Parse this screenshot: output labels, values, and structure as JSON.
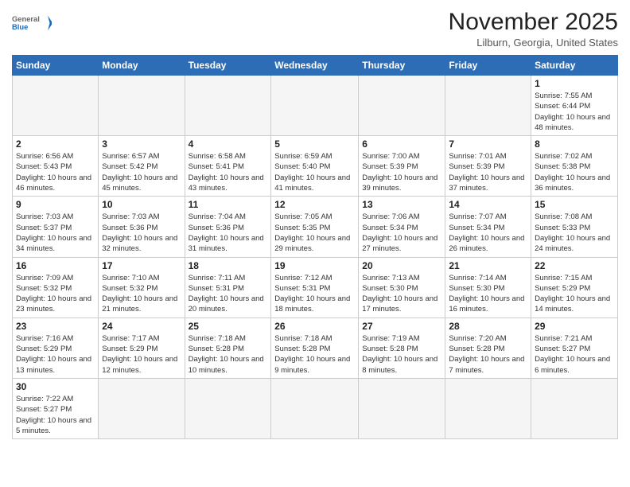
{
  "header": {
    "logo_general": "General",
    "logo_blue": "Blue",
    "month_title": "November 2025",
    "location": "Lilburn, Georgia, United States"
  },
  "days_of_week": [
    "Sunday",
    "Monday",
    "Tuesday",
    "Wednesday",
    "Thursday",
    "Friday",
    "Saturday"
  ],
  "weeks": [
    [
      {
        "day": "",
        "info": ""
      },
      {
        "day": "",
        "info": ""
      },
      {
        "day": "",
        "info": ""
      },
      {
        "day": "",
        "info": ""
      },
      {
        "day": "",
        "info": ""
      },
      {
        "day": "",
        "info": ""
      },
      {
        "day": "1",
        "info": "Sunrise: 7:55 AM\nSunset: 6:44 PM\nDaylight: 10 hours and 48 minutes."
      }
    ],
    [
      {
        "day": "2",
        "info": "Sunrise: 6:56 AM\nSunset: 5:43 PM\nDaylight: 10 hours and 46 minutes."
      },
      {
        "day": "3",
        "info": "Sunrise: 6:57 AM\nSunset: 5:42 PM\nDaylight: 10 hours and 45 minutes."
      },
      {
        "day": "4",
        "info": "Sunrise: 6:58 AM\nSunset: 5:41 PM\nDaylight: 10 hours and 43 minutes."
      },
      {
        "day": "5",
        "info": "Sunrise: 6:59 AM\nSunset: 5:40 PM\nDaylight: 10 hours and 41 minutes."
      },
      {
        "day": "6",
        "info": "Sunrise: 7:00 AM\nSunset: 5:39 PM\nDaylight: 10 hours and 39 minutes."
      },
      {
        "day": "7",
        "info": "Sunrise: 7:01 AM\nSunset: 5:39 PM\nDaylight: 10 hours and 37 minutes."
      },
      {
        "day": "8",
        "info": "Sunrise: 7:02 AM\nSunset: 5:38 PM\nDaylight: 10 hours and 36 minutes."
      }
    ],
    [
      {
        "day": "9",
        "info": "Sunrise: 7:03 AM\nSunset: 5:37 PM\nDaylight: 10 hours and 34 minutes."
      },
      {
        "day": "10",
        "info": "Sunrise: 7:03 AM\nSunset: 5:36 PM\nDaylight: 10 hours and 32 minutes."
      },
      {
        "day": "11",
        "info": "Sunrise: 7:04 AM\nSunset: 5:36 PM\nDaylight: 10 hours and 31 minutes."
      },
      {
        "day": "12",
        "info": "Sunrise: 7:05 AM\nSunset: 5:35 PM\nDaylight: 10 hours and 29 minutes."
      },
      {
        "day": "13",
        "info": "Sunrise: 7:06 AM\nSunset: 5:34 PM\nDaylight: 10 hours and 27 minutes."
      },
      {
        "day": "14",
        "info": "Sunrise: 7:07 AM\nSunset: 5:34 PM\nDaylight: 10 hours and 26 minutes."
      },
      {
        "day": "15",
        "info": "Sunrise: 7:08 AM\nSunset: 5:33 PM\nDaylight: 10 hours and 24 minutes."
      }
    ],
    [
      {
        "day": "16",
        "info": "Sunrise: 7:09 AM\nSunset: 5:32 PM\nDaylight: 10 hours and 23 minutes."
      },
      {
        "day": "17",
        "info": "Sunrise: 7:10 AM\nSunset: 5:32 PM\nDaylight: 10 hours and 21 minutes."
      },
      {
        "day": "18",
        "info": "Sunrise: 7:11 AM\nSunset: 5:31 PM\nDaylight: 10 hours and 20 minutes."
      },
      {
        "day": "19",
        "info": "Sunrise: 7:12 AM\nSunset: 5:31 PM\nDaylight: 10 hours and 18 minutes."
      },
      {
        "day": "20",
        "info": "Sunrise: 7:13 AM\nSunset: 5:30 PM\nDaylight: 10 hours and 17 minutes."
      },
      {
        "day": "21",
        "info": "Sunrise: 7:14 AM\nSunset: 5:30 PM\nDaylight: 10 hours and 16 minutes."
      },
      {
        "day": "22",
        "info": "Sunrise: 7:15 AM\nSunset: 5:29 PM\nDaylight: 10 hours and 14 minutes."
      }
    ],
    [
      {
        "day": "23",
        "info": "Sunrise: 7:16 AM\nSunset: 5:29 PM\nDaylight: 10 hours and 13 minutes."
      },
      {
        "day": "24",
        "info": "Sunrise: 7:17 AM\nSunset: 5:29 PM\nDaylight: 10 hours and 12 minutes."
      },
      {
        "day": "25",
        "info": "Sunrise: 7:18 AM\nSunset: 5:28 PM\nDaylight: 10 hours and 10 minutes."
      },
      {
        "day": "26",
        "info": "Sunrise: 7:18 AM\nSunset: 5:28 PM\nDaylight: 10 hours and 9 minutes."
      },
      {
        "day": "27",
        "info": "Sunrise: 7:19 AM\nSunset: 5:28 PM\nDaylight: 10 hours and 8 minutes."
      },
      {
        "day": "28",
        "info": "Sunrise: 7:20 AM\nSunset: 5:28 PM\nDaylight: 10 hours and 7 minutes."
      },
      {
        "day": "29",
        "info": "Sunrise: 7:21 AM\nSunset: 5:27 PM\nDaylight: 10 hours and 6 minutes."
      }
    ],
    [
      {
        "day": "30",
        "info": "Sunrise: 7:22 AM\nSunset: 5:27 PM\nDaylight: 10 hours and 5 minutes."
      },
      {
        "day": "",
        "info": ""
      },
      {
        "day": "",
        "info": ""
      },
      {
        "day": "",
        "info": ""
      },
      {
        "day": "",
        "info": ""
      },
      {
        "day": "",
        "info": ""
      },
      {
        "day": "",
        "info": ""
      }
    ]
  ]
}
